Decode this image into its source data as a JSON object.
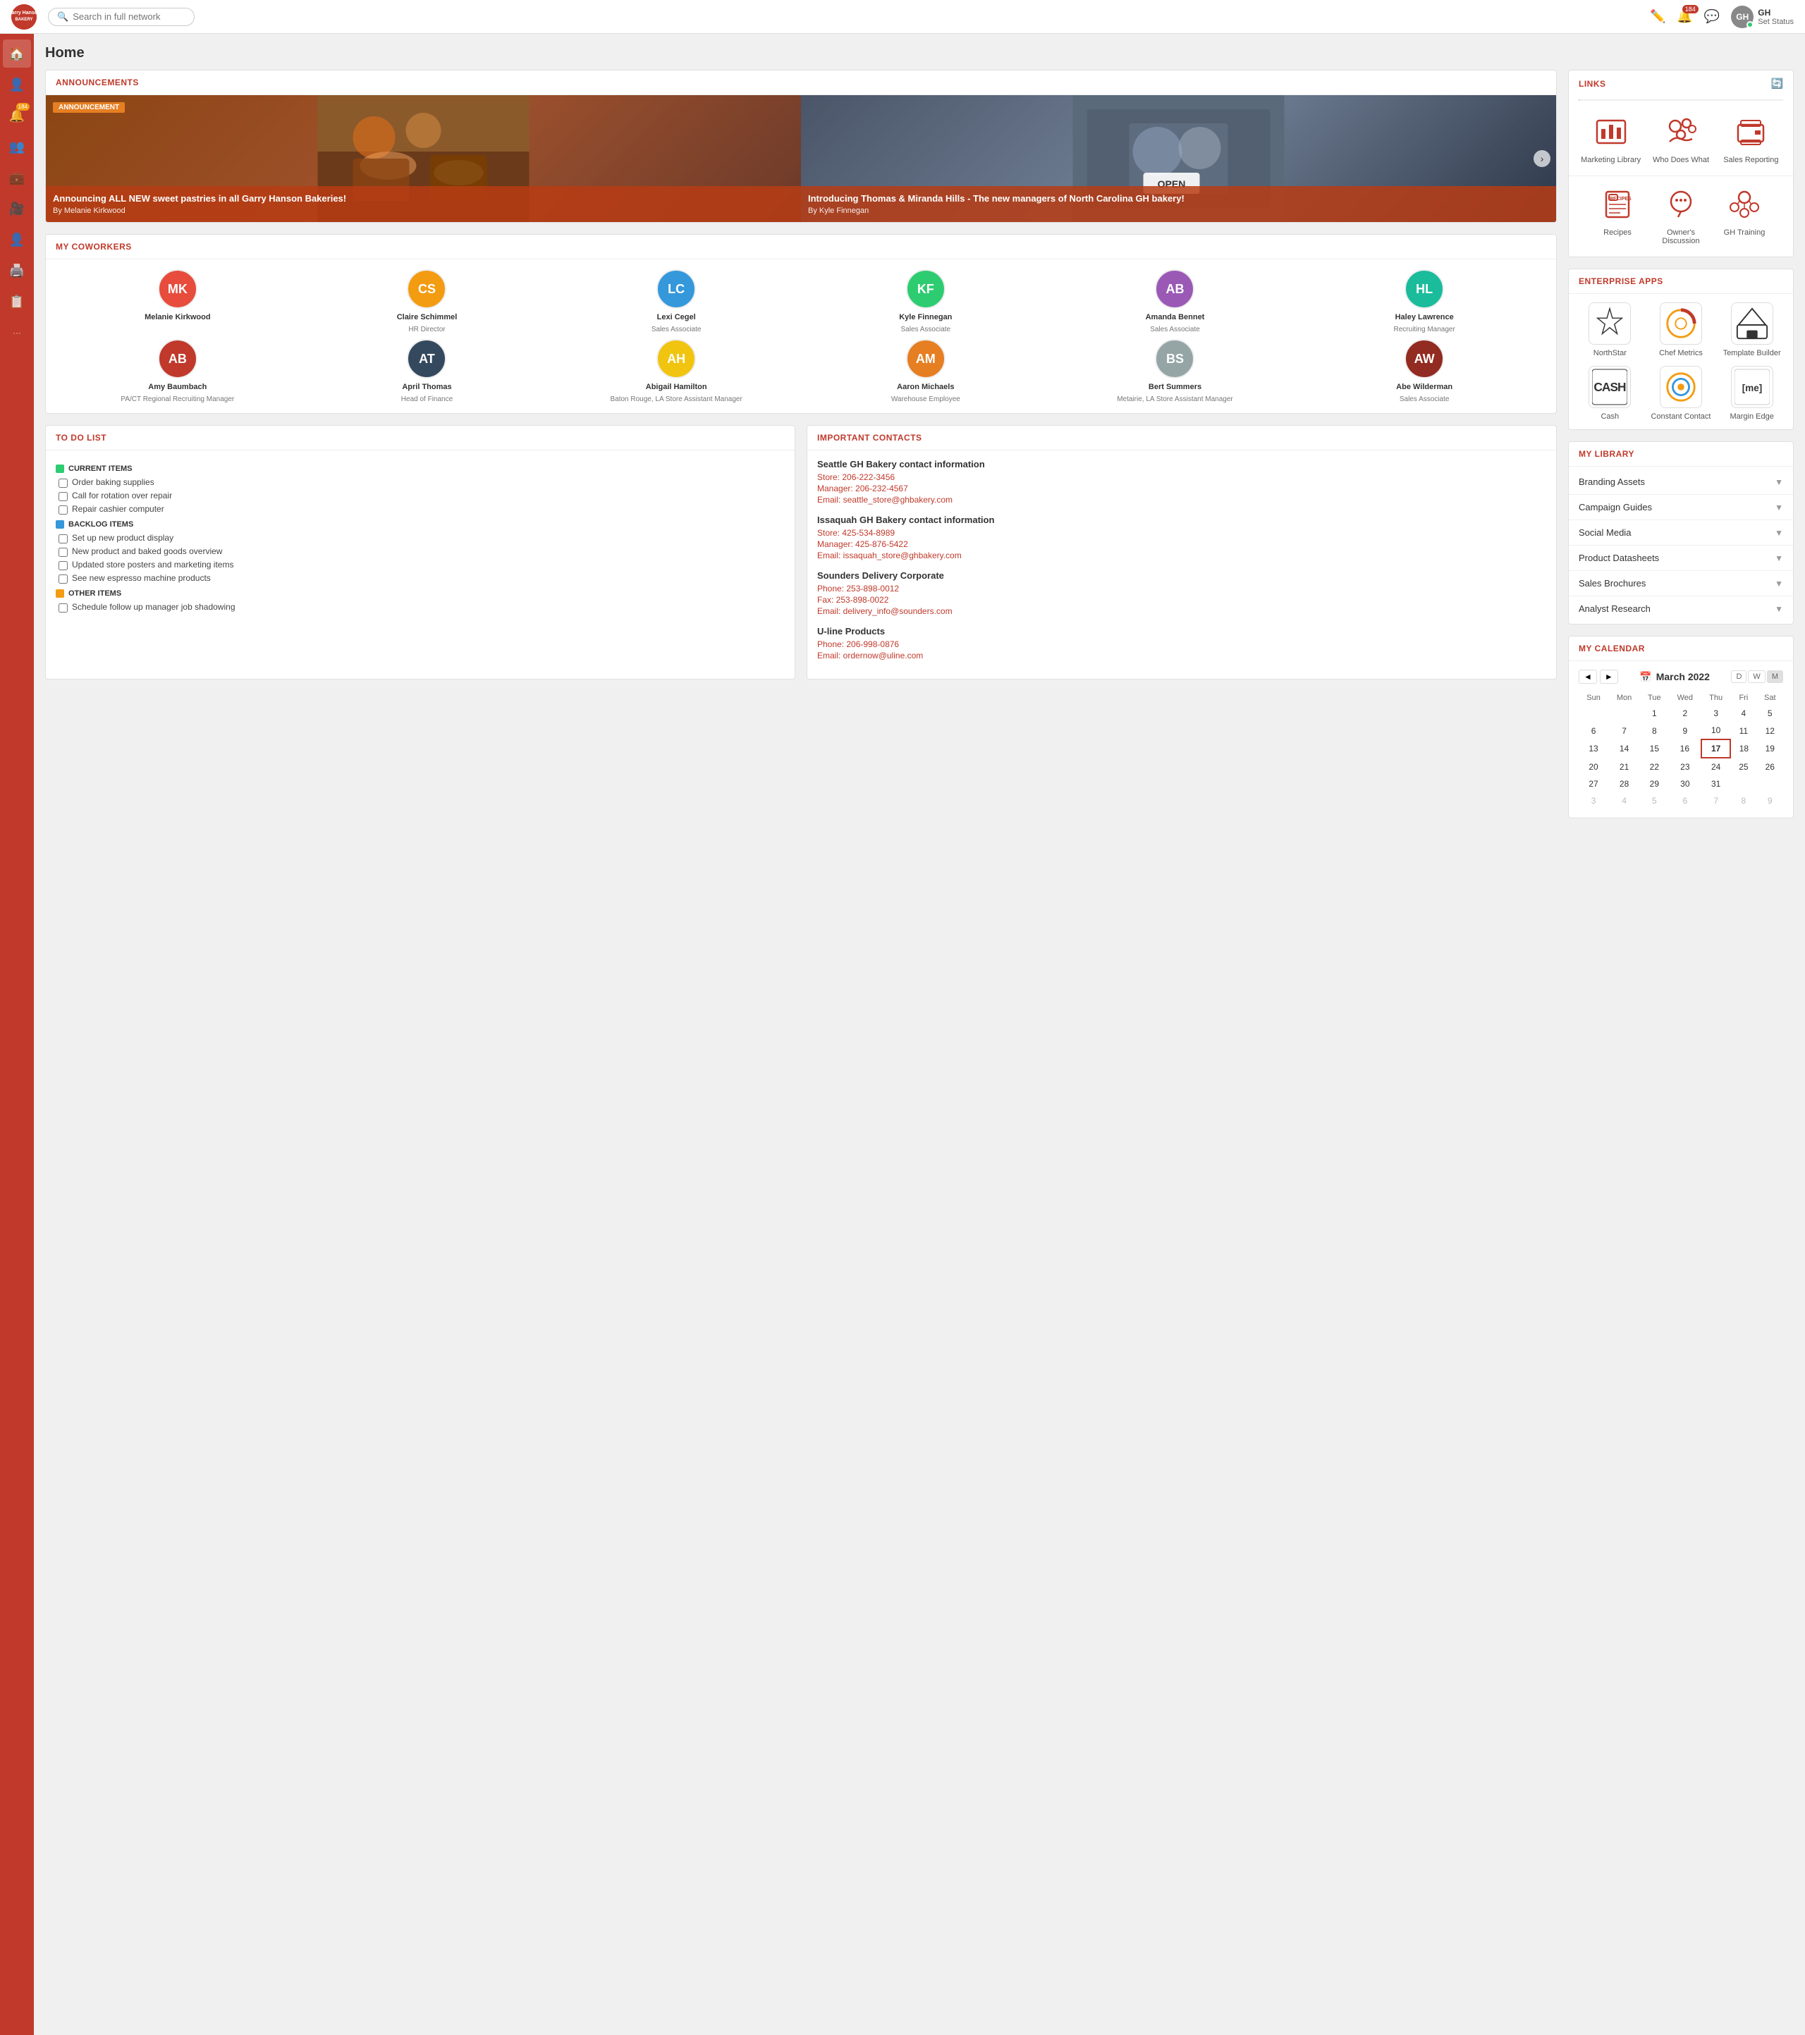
{
  "topnav": {
    "logo_text": "GH",
    "brand_line1": "Garry Hansen",
    "brand_line2": "BAKERY",
    "search_placeholder": "Search in full network",
    "notifications_count": "184",
    "user_initials": "GH",
    "user_name": "GH",
    "user_status": "Set Status"
  },
  "sidebar": {
    "items": [
      {
        "id": "home",
        "icon": "🏠",
        "label": "Home",
        "active": true
      },
      {
        "id": "profile",
        "icon": "👤",
        "label": "Profile"
      },
      {
        "id": "notifications",
        "icon": "🔔",
        "label": "Notifications",
        "badge": "184"
      },
      {
        "id": "people",
        "icon": "👥",
        "label": "People"
      },
      {
        "id": "briefcase",
        "icon": "💼",
        "label": "Jobs"
      },
      {
        "id": "video",
        "icon": "🎥",
        "label": "Video"
      },
      {
        "id": "contacts",
        "icon": "👤",
        "label": "Contacts"
      },
      {
        "id": "print",
        "icon": "🖨️",
        "label": "Print"
      },
      {
        "id": "tasks",
        "icon": "📋",
        "label": "Tasks"
      },
      {
        "id": "more",
        "icon": "···",
        "label": "More"
      }
    ]
  },
  "page": {
    "title": "Home"
  },
  "announcements": {
    "section_title": "ANNOUNCEMENTS",
    "items": [
      {
        "badge": "ANNOUNCEMENT",
        "title": "Announcing ALL NEW sweet pastries in all Garry Hanson Bakeries!",
        "author": "By Melanie Kirkwood",
        "bg_color": "#8B4513"
      },
      {
        "title": "Introducing Thomas & Miranda Hills - The new managers of North Carolina GH bakery!",
        "author": "By Kyle Finnegan",
        "bg_color": "#4a5568"
      }
    ],
    "next_label": "›"
  },
  "coworkers": {
    "section_title": "MY COWORKERS",
    "people": [
      {
        "name": "Melanie Kirkwood",
        "title": "",
        "initials": "MK",
        "color": "av1"
      },
      {
        "name": "Claire Schimmel",
        "title": "HR Director",
        "initials": "CS",
        "color": "av2"
      },
      {
        "name": "Lexi Cegel",
        "title": "Sales Associate",
        "initials": "LC",
        "color": "av3"
      },
      {
        "name": "Kyle Finnegan",
        "title": "Sales Associate",
        "initials": "KF",
        "color": "av4"
      },
      {
        "name": "Amanda Bennet",
        "title": "Sales Associate",
        "initials": "AB",
        "color": "av5"
      },
      {
        "name": "Haley Lawrence",
        "title": "Recruiting Manager",
        "initials": "HL",
        "color": "av6"
      },
      {
        "name": "Amy Baumbach",
        "title": "PA/CT Regional Recruiting Manager",
        "initials": "AB",
        "color": "av7"
      },
      {
        "name": "April Thomas",
        "title": "Head of Finance",
        "initials": "AT",
        "color": "av8"
      },
      {
        "name": "Abigail Hamilton",
        "title": "Baton Rouge, LA Store Assistant Manager",
        "initials": "AH",
        "color": "av9"
      },
      {
        "name": "Aaron Michaels",
        "title": "Warehouse Employee",
        "initials": "AM",
        "color": "av10"
      },
      {
        "name": "Bert Summers",
        "title": "Metairie, LA Store Assistant Manager",
        "initials": "BS",
        "color": "av11"
      },
      {
        "name": "Abe Wilderman",
        "title": "Sales Associate",
        "initials": "AW",
        "color": "av12"
      }
    ]
  },
  "todo": {
    "section_title": "TO DO LIST",
    "categories": [
      {
        "label": "CURRENT ITEMS",
        "color": "green",
        "items": [
          "Order baking supplies",
          "Call for rotation over repair",
          "Repair cashier computer"
        ]
      },
      {
        "label": "BACKLOG ITEMS",
        "color": "blue",
        "items": [
          "Set up new product display",
          "New product and baked goods overview",
          "Updated store posters and marketing items",
          "See new espresso machine products"
        ]
      },
      {
        "label": "OTHER ITEMS",
        "color": "yellow",
        "items": [
          "Schedule follow up manager job shadowing"
        ]
      }
    ]
  },
  "contacts": {
    "section_title": "IMPORTANT CONTACTS",
    "groups": [
      {
        "name": "Seattle GH Bakery contact information",
        "details": [
          "Store: 206-222-3456",
          "Manager: 206-232-4567",
          "Email: seattle_store@ghbakery.com"
        ]
      },
      {
        "name": "Issaquah GH Bakery contact information",
        "details": [
          "Store: 425-534-8989",
          "Manager: 425-876-5422",
          "Email: issaquah_store@ghbakery.com"
        ]
      },
      {
        "name": "Sounders Delivery Corporate",
        "details": [
          "Phone: 253-898-0012",
          "Fax: 253-898-0022",
          "Email: delivery_info@sounders.com"
        ]
      },
      {
        "name": "U-line Products",
        "details": [
          "Phone: 206-998-0876",
          "Email: ordernow@uline.com"
        ]
      }
    ]
  },
  "links": {
    "section_title": "LINKS",
    "items": [
      {
        "label": "Marketing Library",
        "icon": "📊"
      },
      {
        "label": "Who Does What",
        "icon": "👥"
      },
      {
        "label": "Sales Reporting",
        "icon": "🖨️"
      },
      {
        "label": "Recipes",
        "icon": "📋"
      },
      {
        "label": "Owner's Discussion",
        "icon": "💬"
      },
      {
        "label": "GH Training",
        "icon": "🎓"
      }
    ]
  },
  "enterprise_apps": {
    "section_title": "ENTERPRISE APPS",
    "apps": [
      {
        "label": "NorthStar",
        "icon": "⭐"
      },
      {
        "label": "Chef Metrics",
        "icon": "🔄"
      },
      {
        "label": "Template Builder",
        "icon": "🏠"
      },
      {
        "label": "Cash",
        "icon": "CASH"
      },
      {
        "label": "Constant Contact",
        "icon": "🔄"
      },
      {
        "label": "Margin Edge",
        "icon": "[me]"
      }
    ]
  },
  "library": {
    "section_title": "MY LIBRARY",
    "items": [
      "Branding Assets",
      "Campaign Guides",
      "Social Media",
      "Product Datasheets",
      "Sales Brochures",
      "Analyst Research"
    ]
  },
  "calendar": {
    "section_title": "MY CALENDAR",
    "month": "March 2022",
    "view_day": "D",
    "view_week": "W",
    "view_month": "M",
    "days_of_week": [
      "Sun",
      "Mon",
      "Tue",
      "Wed",
      "Thu",
      "Fri",
      "Sat"
    ],
    "weeks": [
      [
        null,
        null,
        1,
        2,
        3,
        4,
        5
      ],
      [
        6,
        7,
        8,
        9,
        10,
        11,
        12
      ],
      [
        13,
        14,
        15,
        16,
        17,
        18,
        19
      ],
      [
        20,
        21,
        22,
        23,
        24,
        25,
        26
      ],
      [
        27,
        28,
        29,
        30,
        31,
        null,
        null
      ],
      [
        3,
        4,
        5,
        6,
        7,
        8,
        9
      ]
    ],
    "today": 17,
    "other_month_weeks": [
      0,
      5
    ]
  }
}
